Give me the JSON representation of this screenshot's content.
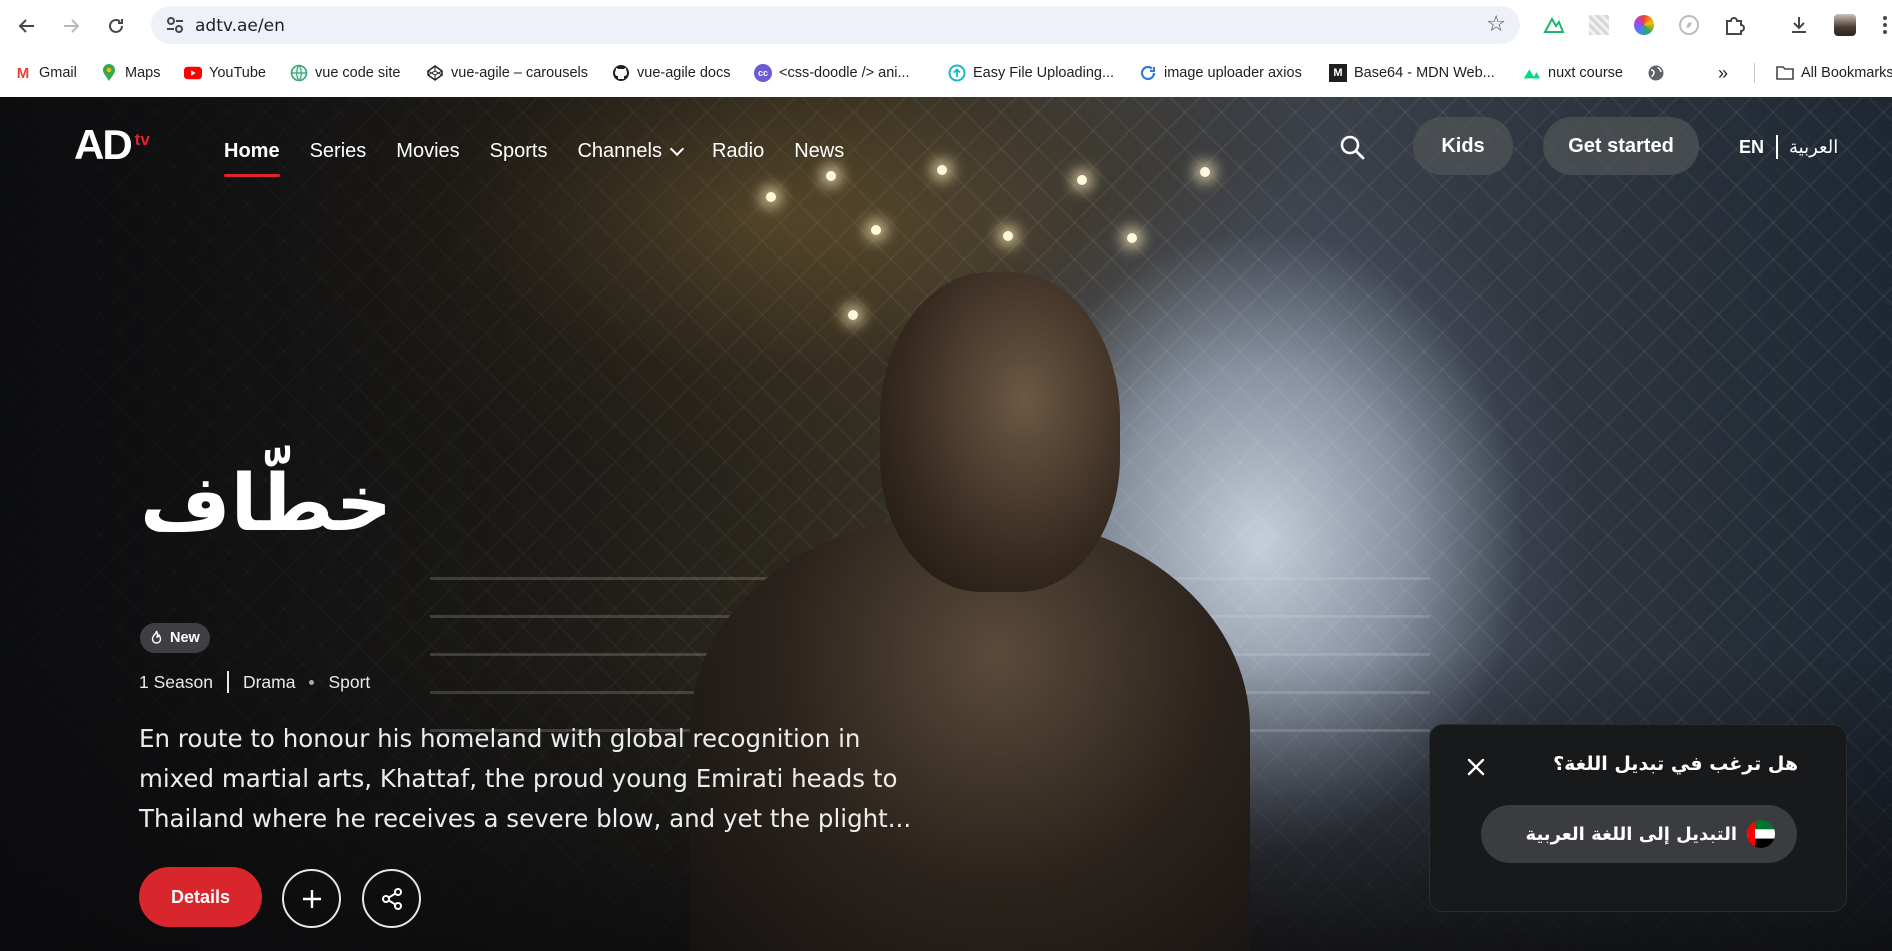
{
  "browser": {
    "url": "adtv.ae/en",
    "bookmarks": [
      {
        "label": "Gmail",
        "icon": "gmail-icon"
      },
      {
        "label": "Maps",
        "icon": "maps-icon"
      },
      {
        "label": "YouTube",
        "icon": "youtube-icon"
      },
      {
        "label": "vue code site",
        "icon": "globe-icon"
      },
      {
        "label": "vue-agile – carousels",
        "icon": "codepen-icon"
      },
      {
        "label": "vue-agile docs",
        "icon": "github-icon"
      },
      {
        "label": "<css-doodle /> ani...",
        "icon": "doodle-icon"
      },
      {
        "label": "Easy File Uploading...",
        "icon": "upload-icon"
      },
      {
        "label": "image uploader axios",
        "icon": "refresh-icon"
      },
      {
        "label": "Base64 - MDN Web...",
        "icon": "mdn-icon"
      },
      {
        "label": "nuxt course",
        "icon": "nuxt-icon"
      }
    ],
    "more_bookmarks": "»",
    "all_bookmarks": "All Bookmarks"
  },
  "site": {
    "logo_main": "AD",
    "logo_sub": "tv",
    "nav": [
      "Home",
      "Series",
      "Movies",
      "Sports",
      "Channels",
      "Radio",
      "News"
    ],
    "active_nav": "Home",
    "kids_label": "Kids",
    "get_started_label": "Get started",
    "lang_en": "EN",
    "lang_ar": "العربية"
  },
  "hero": {
    "title_ar": "خطّاف",
    "badge": "New",
    "seasons": "1 Season",
    "genre1": "Drama",
    "genre2": "Sport",
    "description": "En route to honour his homeland with global recognition in mixed martial arts, Khattaf, the proud young Emirati heads to Thailand where he receives a severe blow, and yet the plight...",
    "details_label": "Details"
  },
  "popup": {
    "question": "هل ترغب في تبديل اللغة؟",
    "switch_label": "التبديل إلى اللغة العربية"
  },
  "colors": {
    "accent": "#d8262c",
    "logo_tv": "#e3232a"
  }
}
